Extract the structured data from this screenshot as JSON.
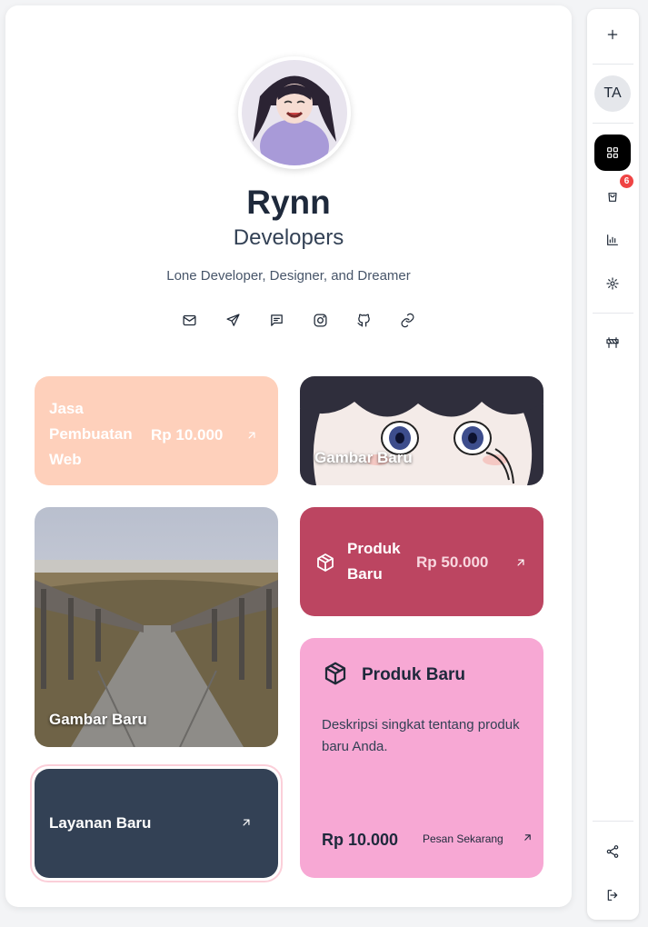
{
  "profile": {
    "name": "Rynn",
    "title": "Developers",
    "bio": "Lone Developer, Designer, and Dreamer"
  },
  "socials": [
    "mail-icon",
    "send-icon",
    "message-icon",
    "instagram-icon",
    "github-icon",
    "link-icon"
  ],
  "tiles": {
    "jasa": {
      "label": "Jasa Pembuatan Web",
      "price": "Rp 10.000"
    },
    "gambar_anime": {
      "label": "Gambar Baru"
    },
    "gambar_bridge": {
      "label": "Gambar Baru"
    },
    "produk_small": {
      "label": "Produk Baru",
      "price": "Rp 50.000"
    },
    "produk_large": {
      "heading": "Produk Baru",
      "description": "Deskripsi singkat tentang produk baru Anda.",
      "price": "Rp 10.000",
      "cta": "Pesan Sekarang"
    },
    "layanan": {
      "label": "Layanan Baru"
    }
  },
  "rail": {
    "avatar_initials": "TA",
    "cart_badge": "6"
  },
  "colors": {
    "peach": "#fed0bb",
    "rose": "#bc4561",
    "pink": "#f7a8d4",
    "slate": "#334155"
  }
}
